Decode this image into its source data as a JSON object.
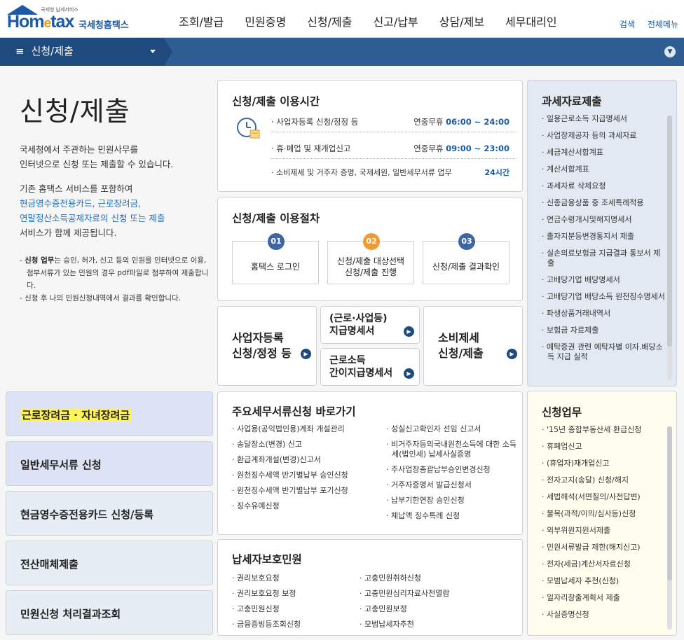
{
  "header": {
    "logo_small": "국세청 납세서비스",
    "logo_main": "Hom",
    "logo_e": "e",
    "logo_tail": "tax",
    "logo_kr": "국세청홈택스",
    "nav": [
      "조회/발급",
      "민원증명",
      "신청/제출",
      "신고/납부",
      "상담/제보",
      "세무대리인"
    ],
    "search": "검색",
    "all_menu": "전체메뉴"
  },
  "breadcrumb": {
    "label": "신청/제출"
  },
  "intro": {
    "title": "신청/제출",
    "p1_l1": "국세청에서 주관하는 민원사무를",
    "p1_l2": "인터넷으로 신청 또는 제출할 수 있습니다.",
    "p2_l1": "기존 홈택스 서비스를 포함하여",
    "p2_l2": "현금영수증전용카드, 근로장려금,",
    "p2_l3": "연말정산소득공제자료의 신청 또는 제출",
    "p2_l4": "서비스가 함께 제공됩니다.",
    "note1_bold": "신청 업무",
    "note1": "는 승인, 허가, 신고 등의 민원을 인터넷으로 이용, 첨부서류가 있는 민원의 경우 pdf파일로 첨부하여 제출합니다.",
    "note2": "신청 후 나의 민원신청내역에서 결과를 확인합니다."
  },
  "hours": {
    "title": "신청/제출 이용시간",
    "rows": [
      {
        "label": "· 사업자등록 신청/정정 등",
        "prefix": "연중무휴",
        "time": "06:00 ~ 24:00"
      },
      {
        "label": "· 휴·폐업 및 재개업신고",
        "prefix": "연중무휴",
        "time": "09:00 ~ 23:00"
      },
      {
        "label": "· 소비제세 및 거주자 증명, 국제세원, 일반세무서류 업무",
        "prefix": "",
        "time": "24시간"
      }
    ]
  },
  "procedure": {
    "title": "신청/제출 이용절차",
    "steps": [
      {
        "num": "01",
        "l1": "홈택스 로그인",
        "l2": ""
      },
      {
        "num": "02",
        "l1": "신청/제출 대상선택",
        "l2": "신청/제출 진행"
      },
      {
        "num": "03",
        "l1": "신청/제출 결과확인",
        "l2": ""
      }
    ]
  },
  "tiles": {
    "t1_l1": "사업자등록",
    "t1_l2": "신청/정정 등",
    "t2_l1": "(근로·사업등)",
    "t2_l2": "지급명세서",
    "t3_l1": "근로소득",
    "t3_l2": "간이지급명세서",
    "t4_l1": "소비제세",
    "t4_l2": "신청/제출"
  },
  "tax_data": {
    "title": "과세자료제출",
    "items": [
      "일용근로소득 지급명세서",
      "사업장제공자 등의 과세자료",
      "세금계산서합계표",
      "계산서합계표",
      "과세자료 삭제요청",
      "신종금융상품 중 조세특례적용",
      "연금수령개시및해지명세서",
      "출자지분등변경통지서 제출",
      "실손의료보험금 지급결과 통보서 제출",
      "고배당기업 배당명세서",
      "고배당기업 배당소득 원천징수명세서",
      "파생상품거래내역서",
      "보험금 자료제출",
      "예탁증권 관련 예탁자별 이자.배당소득 지급 실적"
    ]
  },
  "left_menu": [
    "근로장려금 · 자녀장려금",
    "일반세무서류 신청",
    "현금영수증전용카드 신청/등록",
    "전산매체제출",
    "민원신청 처리결과조회"
  ],
  "docs": {
    "title": "주요세무서류신청 바로가기",
    "col1": [
      "사업용(공익법인용)계좌 개설관리",
      "송달장소(변경) 신고",
      "환급계좌개설(변경)신고서",
      "원천징수세액 반기별납부 승인신청",
      "원천징수세액 반기별납부 포기신청",
      "징수유예신청"
    ],
    "col2": [
      "성실신고확인자 선임 신고서",
      "비거주자등의국내원천소득에 대한 소득세(법인세) 납세사실증명",
      "주사업장총괄납부승인변경신청",
      "거주자증명서 발급신청서",
      "납부기한연장 승인신청",
      "체납액 징수특례 신청"
    ]
  },
  "protect": {
    "title": "납세자보호민원",
    "col1": [
      "권리보호요청",
      "권리보호요청 보정",
      "고충민원신청",
      "금융증빙등조회신청"
    ],
    "col2": [
      "고충민원취하신청",
      "고충민원심리자료사전열람",
      "고충민원보정",
      "모범납세자추천"
    ]
  },
  "apply": {
    "title": "신청업무",
    "items": [
      "'15년 종합부동산세 환급신청",
      "휴폐업신고",
      "(휴업자)재개업신고",
      "전자고지(송달) 신청/해지",
      "세법해석(서면질의/사전답변)",
      "불복(과적/이의/심사등)신청",
      "외부위원지원서제출",
      "민원서류발급 제한(해지신고)",
      "전자(세금)계산서자료신청",
      "모범납세자 추천(신청)",
      "일자리창출계획서 제출",
      "사실증명신청"
    ]
  },
  "colors": {
    "brand": "#1a5aa6",
    "bar": "#2e5d92",
    "accent": "#f19a35",
    "highlight": "#fff35a"
  }
}
